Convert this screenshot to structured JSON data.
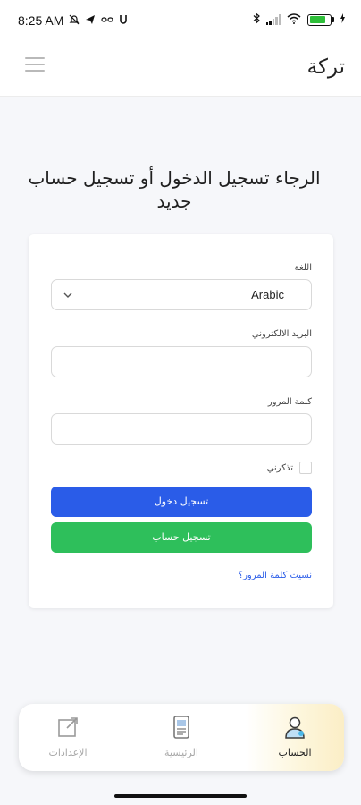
{
  "status_bar": {
    "time": "8:25 AM",
    "left_icons": [
      "mute-icon",
      "telegram-icon",
      "link-icon",
      "u-icon"
    ],
    "right_icons": [
      "bluetooth-icon",
      "signal-icon",
      "wifi-icon",
      "battery-icon"
    ]
  },
  "header": {
    "brand": "تركة",
    "menu_icon": "menu-icon"
  },
  "page": {
    "heading": "الرجاء تسجيل الدخول أو تسجيل حساب جديد"
  },
  "form": {
    "language_label": "اللغة",
    "language_value": "Arabic",
    "email_label": "البريد الالكتروني",
    "email_value": "",
    "password_label": "كلمة المرور",
    "password_value": "",
    "remember_label": "تذكرني",
    "login_button": "تسجيل دخول",
    "register_button": "تسجيل حساب",
    "forgot_link": "نسيت كلمة المرور؟"
  },
  "bottom_nav": {
    "items": [
      {
        "label": "الإعدادات",
        "icon": "external-link-icon",
        "active": false
      },
      {
        "label": "الرئيسية",
        "icon": "document-icon",
        "active": false
      },
      {
        "label": "الحساب",
        "icon": "user-icon",
        "active": true
      }
    ]
  },
  "colors": {
    "primary": "#2a5ce8",
    "success": "#2ebf5b",
    "battery": "#2fbf3a",
    "active_tab": "#fbeec6"
  }
}
